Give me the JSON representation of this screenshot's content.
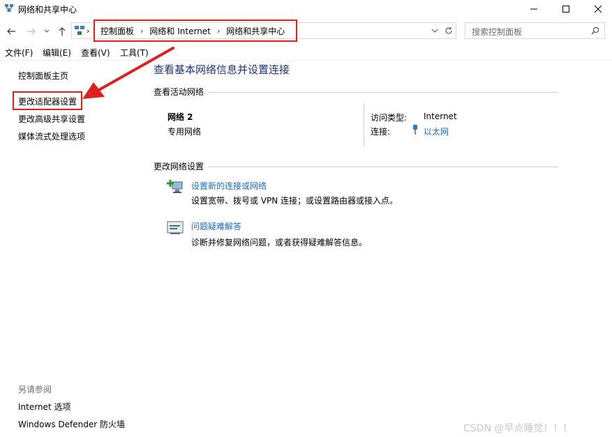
{
  "window": {
    "title": "网络和共享中心",
    "title_icon": "network-center-icon"
  },
  "nav": {
    "back_icon": "arrow-left-icon",
    "forward_icon": "arrow-right-icon",
    "recent_icon": "chevron-down-icon",
    "up_icon": "arrow-up-icon",
    "breadcrumbs": [
      "控制面板",
      "网络和 Internet",
      "网络和共享中心"
    ],
    "search_placeholder": "搜索控制面板"
  },
  "menu": [
    "文件(F)",
    "编辑(E)",
    "查看(V)",
    "工具(T)"
  ],
  "sidebar": {
    "links": [
      "控制面板主页",
      "更改适配器设置",
      "更改高级共享设置",
      "媒体流式处理选项"
    ],
    "see_also_heading": "另请参阅",
    "see_also": [
      "Internet 选项",
      "Windows Defender 防火墙"
    ]
  },
  "main": {
    "title": "查看基本网络信息并设置连接",
    "active_heading": "查看活动网络",
    "network": {
      "name": "网络 2",
      "type": "专用网络",
      "access_label": "访问类型:",
      "access_value": "Internet",
      "connection_label": "连接:",
      "connection_value": "以太网"
    },
    "change_heading": "更改网络设置",
    "actions": [
      {
        "title": "设置新的连接或网络",
        "desc": "设置宽带、拨号或 VPN 连接；或设置路由器或接入点。"
      },
      {
        "title": "问题疑难解答",
        "desc": "诊断并修复网络问题，或者获得疑难解答信息。"
      }
    ]
  },
  "watermark": "CSDN @早点睡觉！！！",
  "colors": {
    "highlight": "#e02020",
    "link": "#1a6bc9",
    "title": "#1e3287"
  }
}
